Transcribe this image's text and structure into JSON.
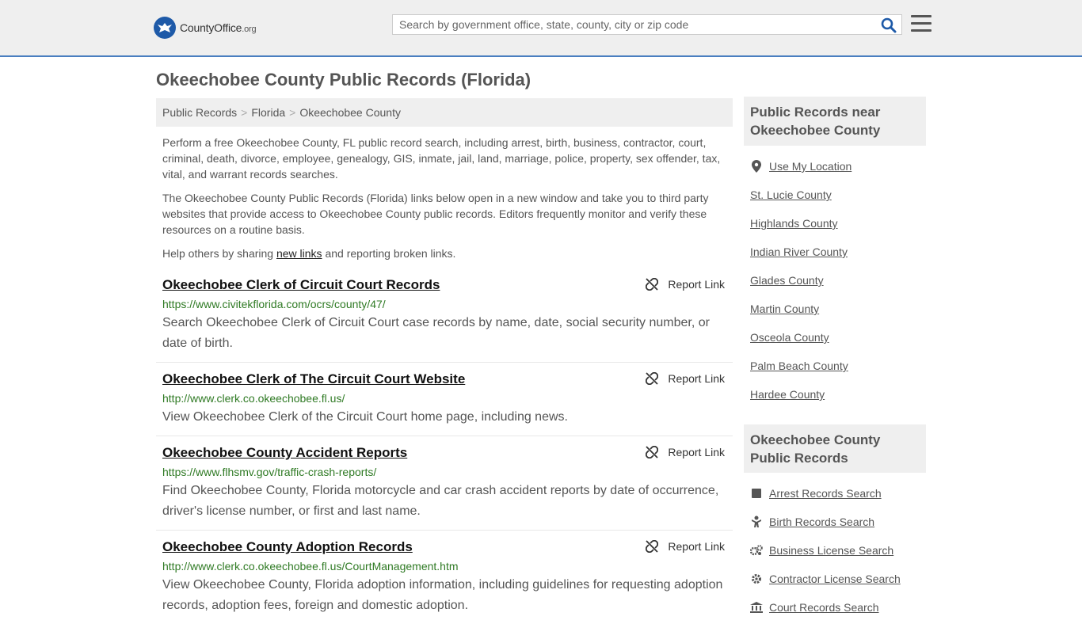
{
  "header": {
    "logo_main": "CountyOffice",
    "logo_tld": ".org",
    "search_placeholder": "Search by government office, state, county, city or zip code"
  },
  "page": {
    "title": "Okeechobee County Public Records (Florida)"
  },
  "breadcrumb": [
    "Public Records",
    "Florida",
    "Okeechobee County"
  ],
  "intro": {
    "p1": "Perform a free Okeechobee County, FL public record search, including arrest, birth, business, contractor, court, criminal, death, divorce, employee, genealogy, GIS, inmate, jail, land, marriage, police, property, sex offender, tax, vital, and warrant records searches.",
    "p2": "The Okeechobee County Public Records (Florida) links below open in a new window and take you to third party websites that provide access to Okeechobee County public records. Editors frequently monitor and verify these resources on a routine basis.",
    "p3_before": "Help others by sharing ",
    "p3_link": "new links",
    "p3_after": " and reporting broken links."
  },
  "report_label": "Report Link",
  "records": [
    {
      "title": "Okeechobee Clerk of Circuit Court Records",
      "url": "https://www.civitekflorida.com/ocrs/county/47/",
      "desc": "Search Okeechobee Clerk of Circuit Court case records by name, date, social security number, or date of birth."
    },
    {
      "title": "Okeechobee Clerk of The Circuit Court Website",
      "url": "http://www.clerk.co.okeechobee.fl.us/",
      "desc": "View Okeechobee Clerk of the Circuit Court home page, including news."
    },
    {
      "title": "Okeechobee County Accident Reports",
      "url": "https://www.flhsmv.gov/traffic-crash-reports/",
      "desc": "Find Okeechobee County, Florida motorcycle and car crash accident reports by date of occurrence, driver's license number, or first and last name."
    },
    {
      "title": "Okeechobee County Adoption Records",
      "url": "http://www.clerk.co.okeechobee.fl.us/CourtManagement.htm",
      "desc": "View Okeechobee County, Florida adoption information, including guidelines for requesting adoption records, adoption fees, foreign and domestic adoption."
    }
  ],
  "sidebar": {
    "nearby_title": "Public Records near Okeechobee County",
    "use_location": "Use My Location",
    "nearby": [
      "St. Lucie County",
      "Highlands County",
      "Indian River County",
      "Glades County",
      "Martin County",
      "Osceola County",
      "Palm Beach County",
      "Hardee County"
    ],
    "records_title": "Okeechobee County Public Records",
    "record_links": [
      {
        "label": "Arrest Records Search",
        "icon": "square-icon"
      },
      {
        "label": "Birth Records Search",
        "icon": "baby-icon"
      },
      {
        "label": "Business License Search",
        "icon": "gears-icon"
      },
      {
        "label": "Contractor License Search",
        "icon": "gear-icon"
      },
      {
        "label": "Court Records Search",
        "icon": "courthouse-icon"
      }
    ]
  },
  "colors": {
    "header_bg": "#efefef",
    "header_border": "#4a7ec0",
    "logo_blue": "#1e5aa8",
    "search_icon": "#1e5aa8",
    "url_green": "#2f7a24"
  }
}
